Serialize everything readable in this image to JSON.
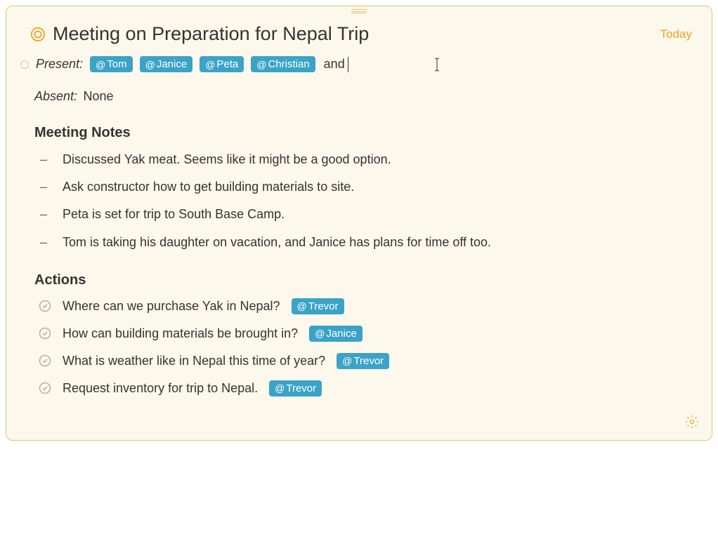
{
  "title": "Meeting on Preparation for Nepal Trip",
  "date_label": "Today",
  "present": {
    "label": "Present:",
    "tags": [
      "Tom",
      "Janice",
      "Peta",
      "Christian"
    ],
    "trailing": "and"
  },
  "absent": {
    "label": "Absent:",
    "value": "None"
  },
  "notes": {
    "heading": "Meeting Notes",
    "items": [
      "Discussed Yak meat. Seems like it might be a good option.",
      "Ask constructor how to get building materials to site.",
      "Peta is set for trip to South Base Camp.",
      "Tom is taking his daughter on vacation, and Janice has plans for time off too."
    ]
  },
  "actions": {
    "heading": "Actions",
    "items": [
      {
        "text": "Where can we purchase Yak in Nepal?",
        "assignee": "Trevor"
      },
      {
        "text": "How can building materials be brought in?",
        "assignee": "Janice"
      },
      {
        "text": "What is weather like in Nepal this time of year?",
        "assignee": "Trevor"
      },
      {
        "text": "Request inventory for trip to Nepal.",
        "assignee": "Trevor"
      }
    ]
  }
}
